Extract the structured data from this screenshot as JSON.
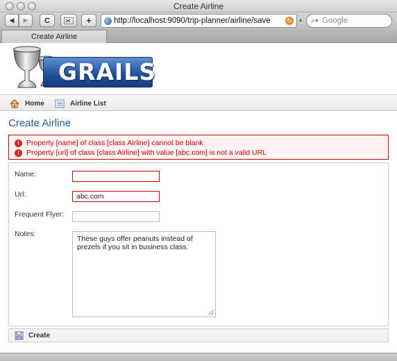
{
  "window": {
    "title": "Create Airline"
  },
  "toolbar": {
    "back_glyph": "◀",
    "forward_glyph": "▶",
    "reload_glyph": "C",
    "add_glyph": "+",
    "url": "http://localhost:9090/trip-planner/airline/save",
    "search_placeholder": "Google"
  },
  "tabs": [
    {
      "label": "Create Airline"
    }
  ],
  "logo": {
    "text": "GRAILS"
  },
  "nav": {
    "home": "Home",
    "list": "Airline List"
  },
  "page": {
    "heading": "Create Airline"
  },
  "errors": [
    "Property [name] of class [class Airline] cannot be blank",
    "Property [url] of class [class Airline] with value [abc.com] is not a valid URL"
  ],
  "form": {
    "name_label": "Name:",
    "name_value": "",
    "url_label": "Url:",
    "url_value": "abc.com",
    "flyer_label": "Frequent Flyer:",
    "flyer_value": "",
    "notes_label": "Notes:",
    "notes_value": "These guys offer peanuts instead of prezels if you sit in business class."
  },
  "buttons": {
    "create": "Create"
  },
  "colors": {
    "error": "#cc0000",
    "heading": "#1f5e9a"
  }
}
